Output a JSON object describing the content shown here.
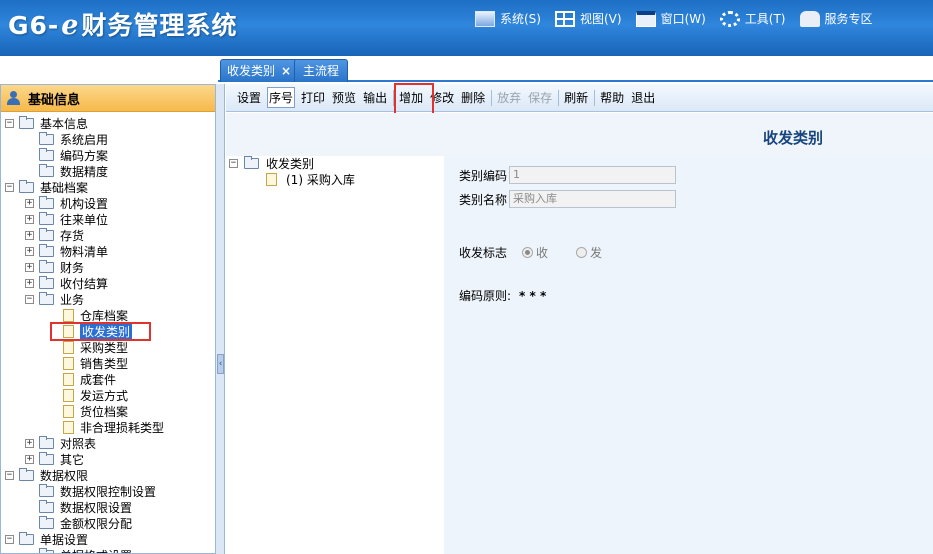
{
  "app": {
    "logo_prefix": "G6-",
    "logo_e": "e",
    "logo_suffix": "财务管理系统"
  },
  "menu": [
    {
      "label": "系统(S)",
      "icon": "computer-icon"
    },
    {
      "label": "视图(V)",
      "icon": "grid-icon"
    },
    {
      "label": "窗口(W)",
      "icon": "window-icon"
    },
    {
      "label": "工具(T)",
      "icon": "gear-icon"
    },
    {
      "label": "服务专区",
      "icon": "person-icon"
    }
  ],
  "tabs": [
    {
      "label": "收发类别",
      "close": "×"
    },
    {
      "label": "主流程"
    }
  ],
  "left": {
    "title": "基础信息",
    "tree": [
      {
        "label": "基本信息",
        "level": 0,
        "pm": "−",
        "icon": "folder"
      },
      {
        "label": "系统启用",
        "level": 1,
        "icon": "folder"
      },
      {
        "label": "编码方案",
        "level": 1,
        "icon": "folder"
      },
      {
        "label": "数据精度",
        "level": 1,
        "icon": "folder"
      },
      {
        "label": "基础档案",
        "level": 0,
        "pm": "−",
        "icon": "folder"
      },
      {
        "label": "机构设置",
        "level": 1,
        "pm": "+",
        "icon": "folder"
      },
      {
        "label": "往来单位",
        "level": 1,
        "pm": "+",
        "icon": "folder"
      },
      {
        "label": "存货",
        "level": 1,
        "pm": "+",
        "icon": "folder"
      },
      {
        "label": "物料清单",
        "level": 1,
        "pm": "+",
        "icon": "folder"
      },
      {
        "label": "财务",
        "level": 1,
        "pm": "+",
        "icon": "folder"
      },
      {
        "label": "收付结算",
        "level": 1,
        "pm": "+",
        "icon": "folder"
      },
      {
        "label": "业务",
        "level": 1,
        "pm": "−",
        "icon": "folder"
      },
      {
        "label": "仓库档案",
        "level": 2,
        "icon": "file"
      },
      {
        "label": "收发类别",
        "level": 2,
        "icon": "file",
        "selected": true
      },
      {
        "label": "采购类型",
        "level": 2,
        "icon": "file"
      },
      {
        "label": "销售类型",
        "level": 2,
        "icon": "file"
      },
      {
        "label": "成套件",
        "level": 2,
        "icon": "file"
      },
      {
        "label": "发运方式",
        "level": 2,
        "icon": "file"
      },
      {
        "label": "货位档案",
        "level": 2,
        "icon": "file"
      },
      {
        "label": "非合理损耗类型",
        "level": 2,
        "icon": "file"
      },
      {
        "label": "对照表",
        "level": 1,
        "pm": "+",
        "icon": "folder"
      },
      {
        "label": "其它",
        "level": 1,
        "pm": "+",
        "icon": "folder"
      },
      {
        "label": "数据权限",
        "level": 0,
        "pm": "−",
        "icon": "folder"
      },
      {
        "label": "数据权限控制设置",
        "level": 1,
        "icon": "folder"
      },
      {
        "label": "数据权限设置",
        "level": 1,
        "icon": "folder"
      },
      {
        "label": "金额权限分配",
        "level": 1,
        "icon": "folder"
      },
      {
        "label": "单据设置",
        "level": 0,
        "pm": "−",
        "icon": "folder"
      },
      {
        "label": "单据格式设置",
        "level": 1,
        "icon": "folder"
      }
    ]
  },
  "toolbar": [
    {
      "label": "设置"
    },
    {
      "label": "序号",
      "selected": true
    },
    {
      "label": "打印"
    },
    {
      "label": "预览"
    },
    {
      "label": "输出"
    },
    {
      "sep": true
    },
    {
      "label": "增加",
      "highlight": true
    },
    {
      "label": "修改"
    },
    {
      "label": "删除"
    },
    {
      "sep": true
    },
    {
      "label": "放弃",
      "disabled": true
    },
    {
      "label": "保存",
      "disabled": true
    },
    {
      "sep": true
    },
    {
      "label": "刷新"
    },
    {
      "sep": true
    },
    {
      "label": "帮助"
    },
    {
      "label": "退出"
    }
  ],
  "content": {
    "title": "收发类别",
    "tree_root": "收发类别",
    "tree_child": "(1) 采购入库",
    "form": {
      "code_label": "类别编码",
      "code_value": "1",
      "name_label": "类别名称",
      "name_value": "采购入库",
      "flag_label": "收发标志",
      "flag_in": "收",
      "flag_out": "发",
      "flag_selected": "收",
      "rule_label": "编码原则:",
      "rule_value": "* * *"
    }
  },
  "colors": {
    "header": "#2f86dc",
    "left_head": "#f7b94a",
    "selection": "#2b6fd3",
    "highlight_box": "#e0322f"
  }
}
